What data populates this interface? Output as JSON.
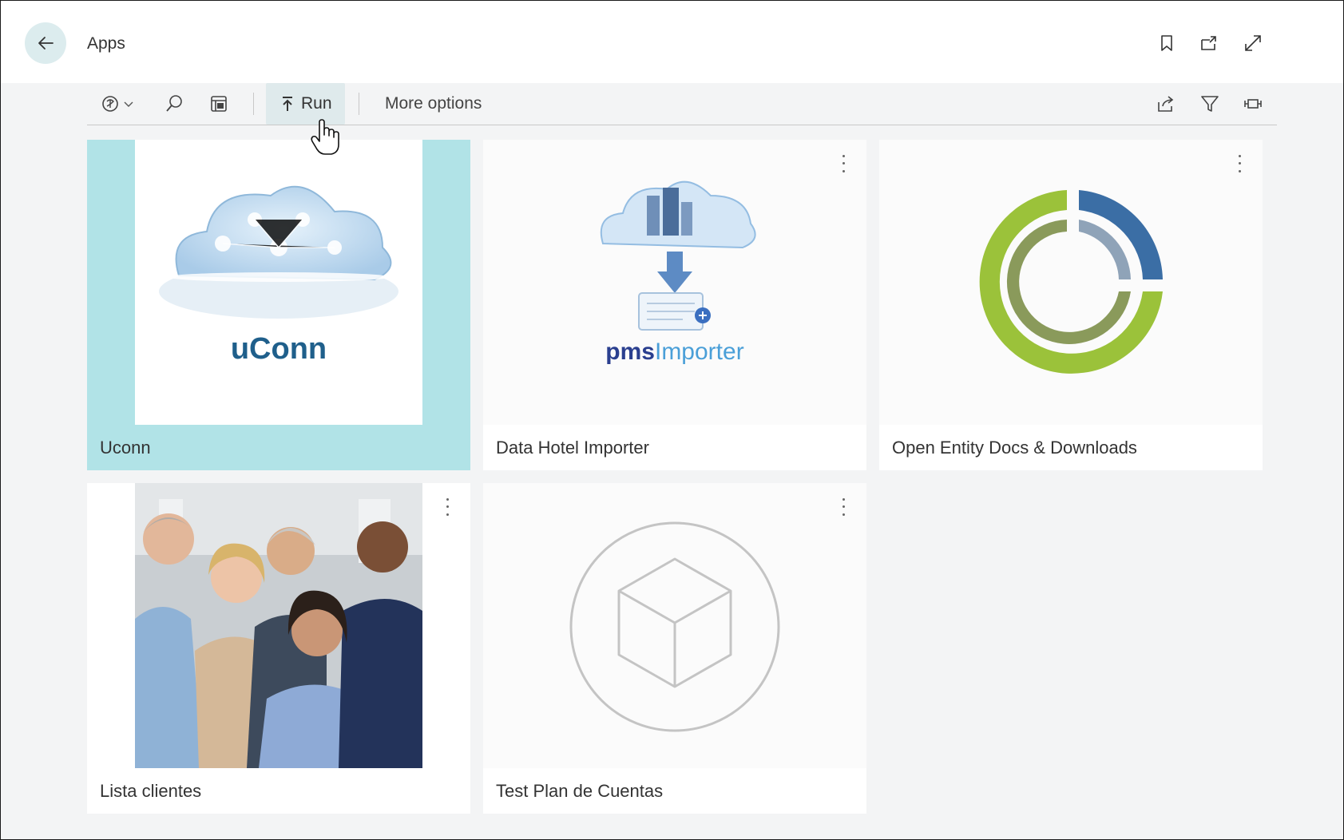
{
  "header": {
    "title": "Apps"
  },
  "toolbar": {
    "run_label": "Run",
    "more_options_label": "More options"
  },
  "tiles": [
    {
      "label": "Uconn",
      "image_text": "uConn"
    },
    {
      "label": "Data Hotel Importer",
      "image_text_a": "pms",
      "image_text_b": "Importer"
    },
    {
      "label": "Open Entity Docs & Downloads"
    },
    {
      "label": "Lista clientes"
    },
    {
      "label": "Test Plan de Cuentas"
    }
  ],
  "colors": {
    "selection": "#b1e3e7",
    "back_button_bg": "#dcecee",
    "uconn_brand": "#1f5f8b",
    "pms_brand": "#2a3f8f",
    "importer_brand": "#4a9fd8",
    "entity_green": "#9bc23a",
    "entity_blue": "#3b6ea5"
  },
  "icons": [
    "back-arrow-icon",
    "bookmark-icon",
    "open-new-window-icon",
    "expand-icon",
    "copilot-icon",
    "chevron-down-icon",
    "search-icon",
    "layout-icon",
    "run-icon",
    "share-icon",
    "filter-icon",
    "collapse-icon",
    "more-vertical-icon",
    "package-icon",
    "hand-cursor-icon"
  ]
}
